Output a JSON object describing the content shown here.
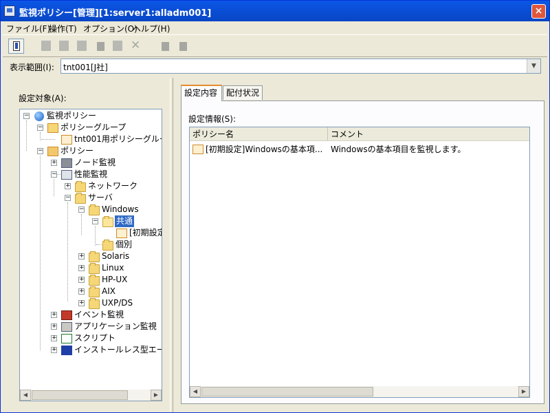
{
  "window": {
    "title": "監視ポリシー[管理][1:server1:alladm001]",
    "close_glyph": "×"
  },
  "menu": [
    {
      "label": "ファイル(F)"
    },
    {
      "label": "操作(T)"
    },
    {
      "label": "オプション(O)"
    },
    {
      "label": "ヘルプ(H)"
    }
  ],
  "toolbar": {
    "buttons": [
      {
        "icon": "open-document-icon",
        "enabled": true
      },
      {
        "icon": "new-icon",
        "enabled": false
      },
      {
        "icon": "copy-icon",
        "enabled": false
      },
      {
        "icon": "edit-icon",
        "enabled": false
      },
      {
        "icon": "print-icon",
        "enabled": false
      },
      {
        "icon": "duplicate-icon",
        "enabled": false
      },
      {
        "icon": "delete-icon",
        "enabled": false
      },
      {
        "icon": "distribute-icon",
        "enabled": false
      },
      {
        "icon": "distribute-all-icon",
        "enabled": false
      }
    ]
  },
  "scope": {
    "label": "表示範囲(I):",
    "value": "tnt001[J社]",
    "arrow": "▼"
  },
  "left": {
    "label": "設定対象(A):",
    "tree": [
      {
        "label": "監視ポリシー",
        "icon": "globe-icon",
        "level": 0,
        "expander": "−"
      },
      {
        "label": "ポリシーグループ",
        "icon": "policy-group-icon",
        "level": 1,
        "expander": "−"
      },
      {
        "label": "tnt001用ポリシーグルー",
        "icon": "policy-doc-icon",
        "level": 2,
        "expander": ""
      },
      {
        "label": "ポリシー",
        "icon": "policy-icon",
        "level": 1,
        "expander": "−"
      },
      {
        "label": "ノード監視",
        "icon": "node-monitor-icon",
        "level": 2,
        "expander": "+"
      },
      {
        "label": "性能監視",
        "icon": "performance-icon",
        "level": 2,
        "expander": "−"
      },
      {
        "label": "ネットワーク",
        "icon": "folder-icon",
        "level": 3,
        "expander": "+"
      },
      {
        "label": "サーバ",
        "icon": "folder-icon",
        "level": 3,
        "expander": "−"
      },
      {
        "label": "Windows",
        "icon": "folder-icon",
        "level": 4,
        "expander": "−"
      },
      {
        "label": "共通",
        "icon": "folder-open-icon",
        "level": 5,
        "expander": "−",
        "selected": true
      },
      {
        "label": "[初期設定",
        "icon": "policy-doc-icon",
        "level": 6,
        "expander": ""
      },
      {
        "label": "個別",
        "icon": "folder-icon",
        "level": 5,
        "expander": ""
      },
      {
        "label": "Solaris",
        "icon": "folder-icon",
        "level": 4,
        "expander": "+"
      },
      {
        "label": "Linux",
        "icon": "folder-icon",
        "level": 4,
        "expander": "+"
      },
      {
        "label": "HP-UX",
        "icon": "folder-icon",
        "level": 4,
        "expander": "+"
      },
      {
        "label": "AIX",
        "icon": "folder-icon",
        "level": 4,
        "expander": "+"
      },
      {
        "label": "UXP/DS",
        "icon": "folder-icon",
        "level": 4,
        "expander": "+"
      },
      {
        "label": "イベント監視",
        "icon": "event-monitor-icon",
        "level": 2,
        "expander": "+"
      },
      {
        "label": "アプリケーション監視",
        "icon": "app-monitor-icon",
        "level": 2,
        "expander": "+"
      },
      {
        "label": "スクリプト",
        "icon": "script-icon",
        "level": 2,
        "expander": "+"
      },
      {
        "label": "インストールレス型エー",
        "icon": "installless-agent-icon",
        "level": 2,
        "expander": "+"
      }
    ]
  },
  "right": {
    "tabs": [
      {
        "label": "設定内容",
        "active": true
      },
      {
        "label": "配付状況",
        "active": false
      }
    ],
    "info_label": "設定情報(S):",
    "columns": [
      "ポリシー名",
      "コメント"
    ],
    "rows": [
      {
        "name": "[初期設定]Windowsの基本項...",
        "comment": "Windowsの基本項目を監視します。"
      }
    ]
  },
  "scroll_glyphs": {
    "left": "◀",
    "right": "▶"
  }
}
